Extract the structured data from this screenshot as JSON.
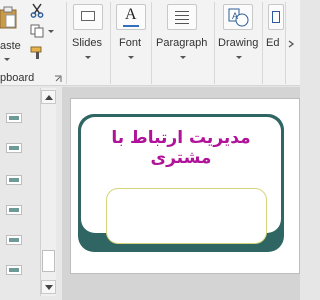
{
  "ribbon": {
    "clipboard": {
      "paste_label": "aste",
      "group_label": "pboard"
    },
    "buttons": [
      {
        "label": "Slides",
        "icon": "slides-icon"
      },
      {
        "label": "Font",
        "icon": "font-icon"
      },
      {
        "label": "Paragraph",
        "icon": "paragraph-icon"
      },
      {
        "label": "Drawing",
        "icon": "drawing-icon"
      },
      {
        "label": "Ed",
        "icon": "editing-icon"
      }
    ],
    "accent": "#2f6663"
  },
  "slide": {
    "title": "مدیریت ارتباط با مشتری",
    "title_color": "#b0129a",
    "frame_color": "#2f6663"
  }
}
